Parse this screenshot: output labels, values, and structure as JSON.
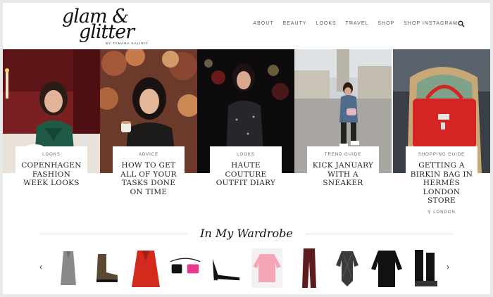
{
  "brand": {
    "logo_line1": "glam &",
    "logo_line2": "glitter",
    "byline": "BY TAMARA KALINIC"
  },
  "nav": {
    "items": [
      "ABOUT",
      "BEAUTY",
      "LOOKS",
      "TRAVEL",
      "SHOP",
      "SHOP INSTAGRAM"
    ],
    "search_icon": "search-icon"
  },
  "features": [
    {
      "category": "LOOKS",
      "title": "COPENHAGEN FASHION WEEK LOOKS",
      "location": ""
    },
    {
      "category": "ADVICE",
      "title": "HOW TO GET ALL OF YOUR TASKS DONE ON TIME",
      "location": ""
    },
    {
      "category": "LOOKS",
      "title": "HAUTE COUTURE OUTFIT DIARY",
      "location": ""
    },
    {
      "category": "TREND GUIDE",
      "title": "KICK JANUARY WITH A SNEAKER",
      "location": ""
    },
    {
      "category": "SHOPPING GUIDE",
      "title": "GETTING A BIRKIN BAG IN HERMÈS LONDON STORE",
      "location": "LONDON"
    }
  ],
  "wardrobe": {
    "title": "In My Wardrobe",
    "prev_icon": "chevron-left-icon",
    "next_icon": "chevron-right-icon",
    "items": [
      "grey-coat",
      "combat-boots",
      "red-coat",
      "belt-bags",
      "black-pumps",
      "pink-sweater",
      "burgundy-pants",
      "sheer-bodysuit",
      "black-sweater",
      "chelsea-boots"
    ]
  },
  "colors": {
    "accent": "#222222",
    "nav_text": "#555555",
    "background": "#ffffff"
  }
}
